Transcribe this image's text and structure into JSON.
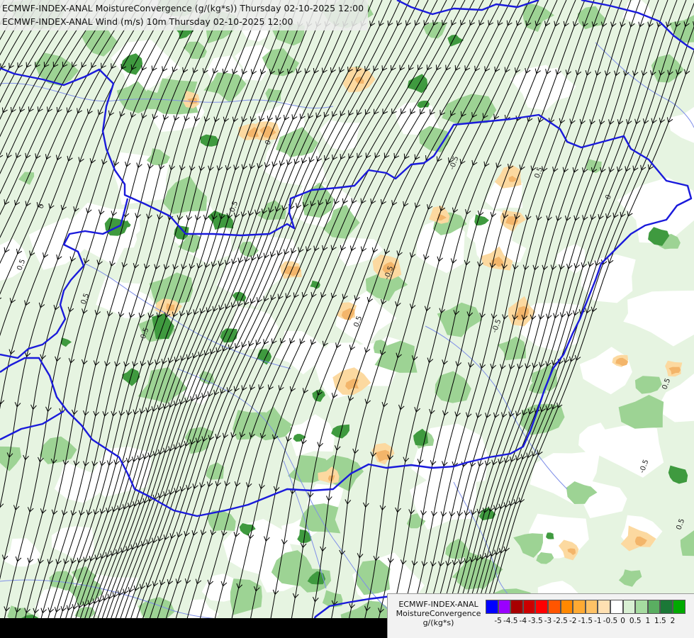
{
  "header": {
    "line1": "ECMWF-INDEX-ANAL MoistureConvergence (g/(kg*s)) Thursday 02-10-2025 12:00",
    "line2": "ECMWF-INDEX-ANAL Wind (m/s) 10m Thursday 02-10-2025 12:00"
  },
  "legend": {
    "title_line1": "ECMWF-INDEX-ANAL",
    "title_line2": "MoistureConvergence",
    "title_line3": "g/(kg*s)",
    "tick_labels": [
      "-5",
      "-4.5",
      "-4",
      "-3.5",
      "-3",
      "-2.5",
      "-2",
      "-1.5",
      "-1",
      "-0.5",
      "0",
      "0.5",
      "1",
      "1.5",
      "2"
    ],
    "colors": [
      "#0000ff",
      "#9a00ff",
      "#a80000",
      "#cc0000",
      "#ff0000",
      "#ff5500",
      "#ff8800",
      "#ffaa33",
      "#ffc266",
      "#ffe0b2",
      "#ffffff",
      "#d9f0d3",
      "#a6dba0",
      "#5aae61",
      "#1b7837",
      "#00aa00"
    ]
  },
  "map": {
    "contour_labels": [
      "0",
      "0.5",
      "-0.5",
      "0.5",
      "-0.5",
      "0.5",
      "0",
      "0.5",
      "-0.5",
      "0.5",
      "-0.5",
      "0.5",
      "0",
      "0.5",
      "-0.5"
    ],
    "colors": {
      "border": "#1a1adb",
      "river": "#7f8fe8",
      "streamline": "#000000",
      "green_light": "#cfeac8",
      "green_mid": "#9dd394",
      "green_dark": "#3f9a3f",
      "orange_light": "#fcd9a0",
      "orange_mid": "#f3b56a"
    }
  }
}
